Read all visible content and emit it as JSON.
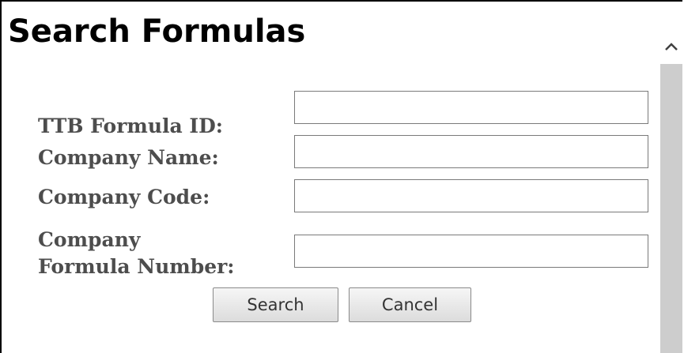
{
  "page": {
    "title": "Search Formulas"
  },
  "form": {
    "fields": [
      {
        "label": "TTB Formula ID:",
        "value": ""
      },
      {
        "label": "Company Name:",
        "value": ""
      },
      {
        "label": "Company Code:",
        "value": ""
      },
      {
        "label_line1": "Company",
        "label_line2": "Formula Number:",
        "value": ""
      }
    ],
    "search_label": "Search",
    "cancel_label": "Cancel"
  },
  "scrollbar": {
    "up_icon": "chevron-up-icon"
  }
}
